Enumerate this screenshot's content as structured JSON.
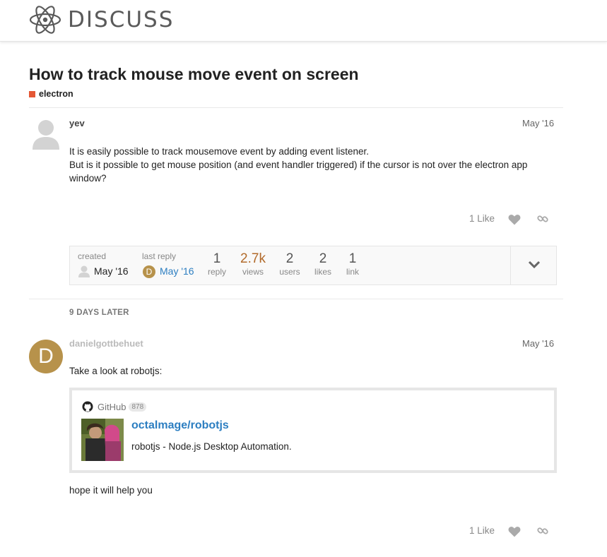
{
  "header": {
    "brand": "DISCUSS"
  },
  "topic": {
    "title": "How to track mouse move event on screen",
    "category": "electron",
    "category_color": "#e45735"
  },
  "post1": {
    "username": "yev",
    "date": "May '16",
    "text_line1": "It is easily possible to track mousemove event by adding event listener.",
    "text_line2": "But is it possible to get mouse position (and event handler triggered) if the cursor is not over the electron app",
    "text_line3": "window?",
    "likes": "1 Like"
  },
  "topic_map": {
    "created_label": "created",
    "created_value": "May '16",
    "last_reply_label": "last reply",
    "last_reply_value": "May '16",
    "last_reply_avatar_letter": "D",
    "stats": [
      {
        "value": "1",
        "label": "reply"
      },
      {
        "value": "2.7k",
        "label": "views"
      },
      {
        "value": "2",
        "label": "users"
      },
      {
        "value": "2",
        "label": "likes"
      },
      {
        "value": "1",
        "label": "link"
      }
    ]
  },
  "time_gap": "9 DAYS LATER",
  "post2": {
    "username": "danielgottbehuet",
    "date": "May '16",
    "avatar_letter": "D",
    "avatar_color": "#b7924b",
    "intro": "Take a look at robotjs:",
    "onebox": {
      "source": "GitHub",
      "count": "878",
      "title": "octalmage/robotjs",
      "description": "robotjs - Node.js Desktop Automation."
    },
    "outro": "hope it will help you",
    "likes": "1 Like"
  },
  "icons": [
    "atom-logo-icon",
    "heart-icon",
    "link-icon",
    "chevron-down-icon",
    "github-icon",
    "user-avatar-icon"
  ]
}
